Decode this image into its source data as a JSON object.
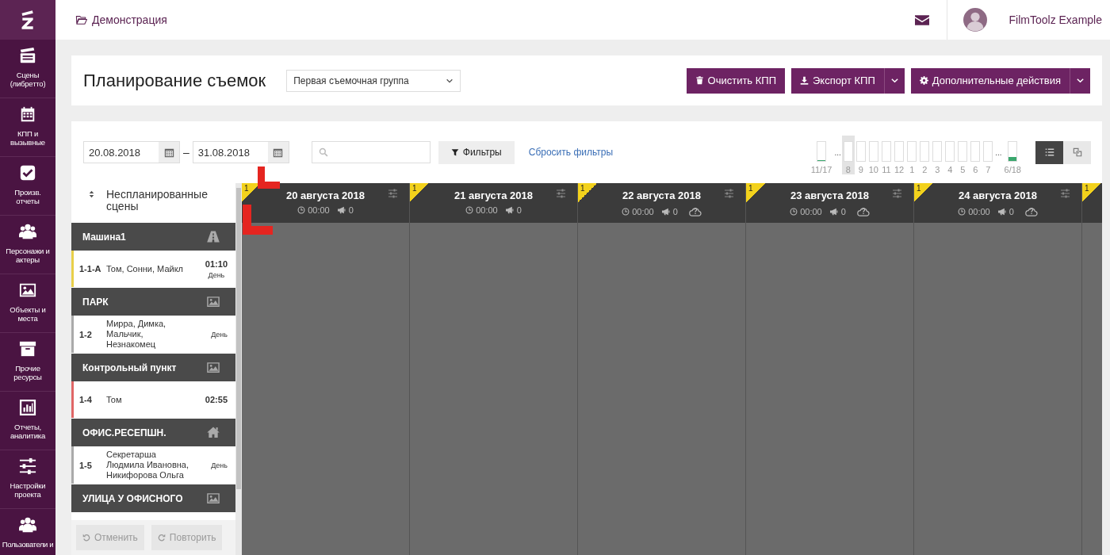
{
  "sidebar": {
    "items": [
      {
        "label": "Сцены (либретто)",
        "kind": "clapper"
      },
      {
        "label": "КПП и вызывные",
        "kind": "calendar"
      },
      {
        "label": "Произв. отчеты",
        "kind": "check"
      },
      {
        "label": "Персонажи и актеры",
        "kind": "users"
      },
      {
        "label": "Объекты и места",
        "kind": "image"
      },
      {
        "label": "Прочие ресурсы",
        "kind": "archive"
      },
      {
        "label": "Отчеты, аналитика",
        "kind": "chart"
      },
      {
        "label": "Настройки проекта",
        "kind": "sliders"
      },
      {
        "label": "Пользователи и",
        "kind": "users"
      }
    ]
  },
  "topbar": {
    "breadcrumb": "Демонстрация",
    "user": "FilmToolz Example"
  },
  "header": {
    "title": "Планирование съемок",
    "crew_select": "Первая съемочная группа",
    "buttons": [
      {
        "label": "Очистить КПП",
        "kind": "trash",
        "dropdown": false
      },
      {
        "label": "Экспорт КПП",
        "kind": "download",
        "dropdown": true
      },
      {
        "label": "Дополнительные действия",
        "kind": "gear",
        "dropdown": true
      }
    ]
  },
  "toolbar": {
    "date_from": "20.08.2018",
    "date_separator": "–",
    "date_to": "31.08.2018",
    "filters_button": "Фильтры",
    "reset_link": "Сбросить фильтры"
  },
  "timeline": [
    {
      "kind": "bar",
      "label": "11/17",
      "level": 0.05,
      "selected": false
    },
    {
      "kind": "ellipsis",
      "label": "..."
    },
    {
      "kind": "bar",
      "label": "8",
      "selected": true
    },
    {
      "kind": "bar",
      "label": "9",
      "selected": false
    },
    {
      "kind": "bar",
      "label": "10",
      "selected": false
    },
    {
      "kind": "bar",
      "label": "11",
      "selected": false
    },
    {
      "kind": "bar",
      "label": "12",
      "selected": false
    },
    {
      "kind": "bar",
      "label": "1",
      "selected": false
    },
    {
      "kind": "bar",
      "label": "2",
      "selected": false
    },
    {
      "kind": "bar",
      "label": "3",
      "selected": false
    },
    {
      "kind": "bar",
      "label": "4",
      "selected": false
    },
    {
      "kind": "bar",
      "label": "5",
      "selected": false
    },
    {
      "kind": "bar",
      "label": "6",
      "selected": false
    },
    {
      "kind": "bar",
      "label": "7",
      "selected": false
    },
    {
      "kind": "ellipsis",
      "label": "..."
    },
    {
      "kind": "bar",
      "label": "6/18",
      "level": 0.2,
      "selected": false
    }
  ],
  "view_toggle": [
    {
      "kind": "list",
      "selected": true
    },
    {
      "kind": "copy",
      "selected": false
    }
  ],
  "unscheduled": {
    "title": "Неспланированные сцены",
    "groups": [
      {
        "name": "Машина1",
        "kind": "road",
        "scenes": [
          {
            "number": "1-1-A",
            "characters": "Том, Сонни, Майкл",
            "duration": "01:10",
            "period": "День",
            "color": "#e8cf4a"
          }
        ]
      },
      {
        "name": "ПАРК",
        "kind": "image",
        "scenes": [
          {
            "number": "1-2",
            "characters": "Мирра, Димка, Мальчик, Незнакомец",
            "period": "День",
            "color": "#aaaaaa"
          }
        ]
      },
      {
        "name": "Контрольный пункт",
        "kind": "image",
        "scenes": [
          {
            "number": "1-4",
            "characters": "Том",
            "duration": "02:55",
            "color": "#e06666"
          }
        ]
      },
      {
        "name": "ОФИС.РЕСЕПШН.",
        "kind": "home",
        "scenes": [
          {
            "number": "1-5",
            "characters": "Секретарша Людмила Ивановна, Никифорова Ольга",
            "period": "День",
            "color": "#aaaaaa"
          }
        ]
      },
      {
        "name": "УЛИЦА У ОФИСНОГО",
        "kind": "image"
      }
    ],
    "undo": {
      "label": "Отменить",
      "disabled": true
    },
    "redo": {
      "label": "Повторить",
      "disabled": true
    }
  },
  "days": [
    {
      "badge": "1",
      "title": "20 августа 2018",
      "time": "00:00",
      "count": "0",
      "weather_unknown": false
    },
    {
      "badge": "1",
      "title": "21 августа 2018",
      "time": "00:00",
      "count": "0",
      "weather_unknown": false
    },
    {
      "badge": "1",
      "title": "22 августа 2018",
      "time": "00:00",
      "count": "0",
      "weather_unknown": true
    },
    {
      "badge": "1",
      "title": "23 августа 2018",
      "time": "00:00",
      "count": "0",
      "weather_unknown": true
    },
    {
      "badge": "1",
      "title": "24 августа 2018",
      "time": "00:00",
      "count": "0",
      "weather_unknown": true
    },
    {
      "badge": "1"
    }
  ]
}
